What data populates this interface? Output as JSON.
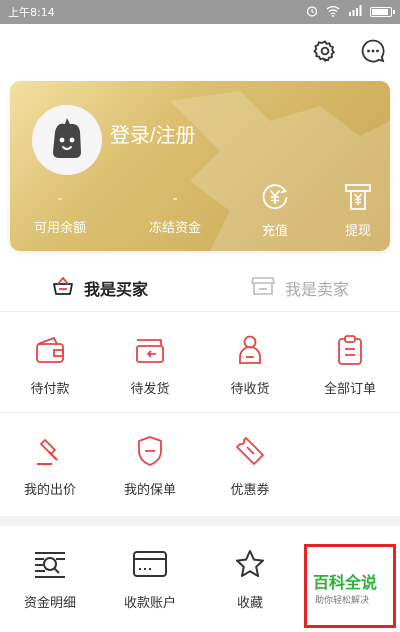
{
  "status_bar": {
    "time": "上午8:14"
  },
  "header": {
    "settings_icon": "gear-icon",
    "message_icon": "chat-bubble-icon"
  },
  "account_card": {
    "login_text": "登录/注册",
    "stats": [
      {
        "value": "-",
        "label": "可用余额"
      },
      {
        "value": "-",
        "label": "冻结资金"
      }
    ],
    "actions": [
      {
        "label": "充值",
        "icon": "recharge-yen-icon"
      },
      {
        "label": "提现",
        "icon": "withdraw-atm-icon"
      }
    ]
  },
  "role_tabs": [
    {
      "label": "我是买家",
      "active": true,
      "icon": "basket-icon"
    },
    {
      "label": "我是卖家",
      "active": false,
      "icon": "store-icon"
    }
  ],
  "order_grid": [
    {
      "label": "待付款",
      "icon": "wallet-icon"
    },
    {
      "label": "待发货",
      "icon": "ship-box-icon"
    },
    {
      "label": "待收货",
      "icon": "receiver-person-icon"
    },
    {
      "label": "全部订单",
      "icon": "clipboard-list-icon"
    }
  ],
  "service_grid": [
    {
      "label": "我的出价",
      "icon": "auction-hammer-icon"
    },
    {
      "label": "我的保单",
      "icon": "shield-icon"
    },
    {
      "label": "优惠券",
      "icon": "coupon-ticket-icon"
    }
  ],
  "tools_grid": [
    {
      "label": "资金明细",
      "icon": "fund-detail-icon"
    },
    {
      "label": "收款账户",
      "icon": "bank-card-icon"
    },
    {
      "label": "收藏",
      "icon": "star-icon"
    }
  ],
  "watermark": {
    "title": "百科全说",
    "subtitle": "助你轻松解决"
  },
  "colors": {
    "accent_red": "#e64545",
    "card_gold": "#d6b965",
    "watermark_green": "#2fae3a"
  }
}
